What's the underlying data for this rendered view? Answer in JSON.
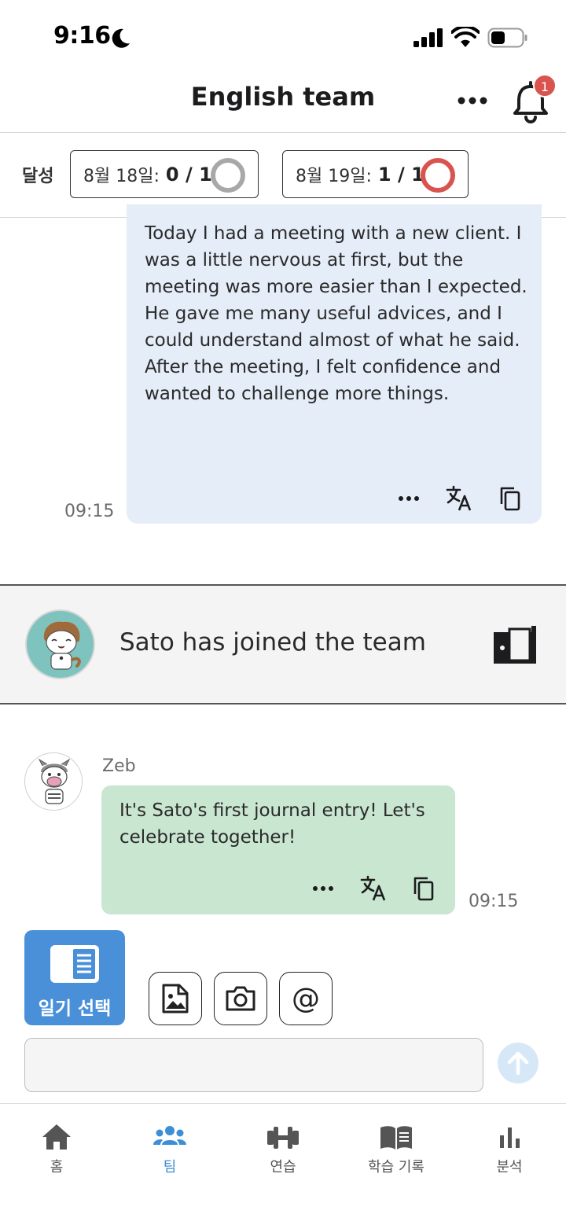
{
  "status_bar": {
    "time": "9:16"
  },
  "header": {
    "title": "English team",
    "notification_count": "1"
  },
  "achievement": {
    "label": "달성",
    "days": [
      {
        "date": "8월 18일:",
        "count": "0 / 1",
        "ring_color": "#a8a8a8"
      },
      {
        "date": "8월 19일:",
        "count": "1 / 1",
        "ring_color": "#d9534f"
      }
    ]
  },
  "messages": {
    "own": {
      "text": "Today I had a meeting with a new client. I was a little nervous at first, but the meeting was more easier than I expected. He gave me many useful advices, and I could understand almost of what he said. After the meeting, I felt confidence and wanted to challenge more things.",
      "time": "09:15"
    },
    "join_event": {
      "text": "Sato has joined the team"
    },
    "bot": {
      "sender": "Zeb",
      "text": "It's Sato's first journal entry! Let's celebrate together!",
      "time": "09:15"
    }
  },
  "composer": {
    "diary_button_label": "일기 선택",
    "mention_symbol": "@",
    "input_value": ""
  },
  "bottom_nav": {
    "items": [
      {
        "label": "홈",
        "icon": "home-icon"
      },
      {
        "label": "팀",
        "icon": "team-icon"
      },
      {
        "label": "연습",
        "icon": "dumbbell-icon"
      },
      {
        "label": "학습 기록",
        "icon": "book-icon"
      },
      {
        "label": "분석",
        "icon": "bar-chart-icon"
      }
    ],
    "active_index": 1
  },
  "colors": {
    "accent": "#3c8fd6",
    "own_bubble": "#e4edf8",
    "bot_bubble": "#c9e6d1",
    "diary_button": "#4a90d9",
    "badge": "#d9534f"
  }
}
